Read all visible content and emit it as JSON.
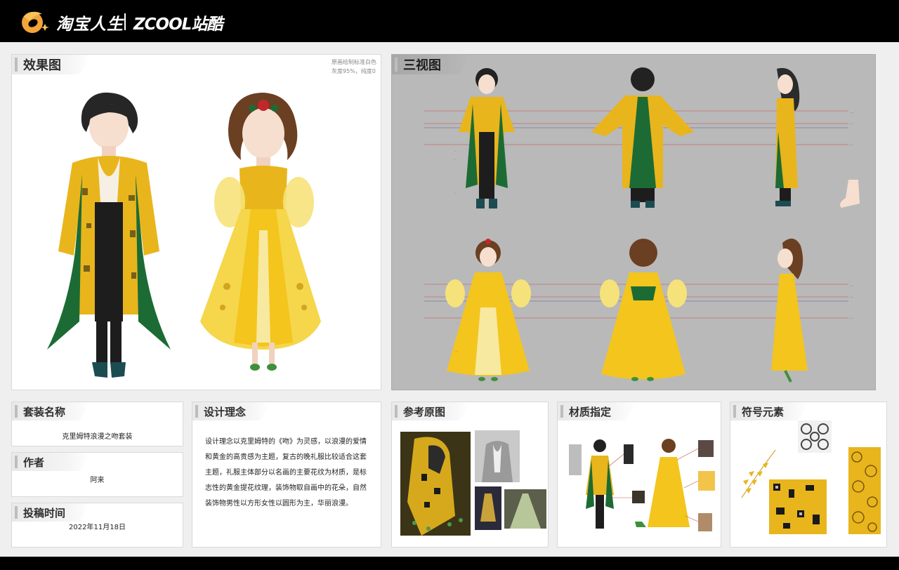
{
  "header": {
    "brand_primary": "淘宝人生",
    "brand_secondary": "ZCOOL站酷",
    "logo_icon": "taobao-life-logo-icon"
  },
  "effect_panel": {
    "title": "效果图",
    "note_line1": "原画绘制标准白色",
    "note_line2": "灰度95%，纯度0"
  },
  "three_view_panel": {
    "title": "三视图"
  },
  "outfit_name": {
    "title": "套装名称",
    "value": "克里姆特浪漫之吻套装"
  },
  "author": {
    "title": "作者",
    "value": "阿来"
  },
  "submit_time": {
    "title": "投稿时间",
    "value": "2022年11月18日"
  },
  "design_concept": {
    "title": "设计理念",
    "lines": [
      "设计理念以克里姆特的《吻》为灵感，以浪漫的爱情",
      "和黄金的高贵感为主题，复古的晚礼服比较适合这套",
      "主题，礼服主体部分以名画的主要花纹为材质，是标",
      "志性的黄金提花纹理，装饰物取自画中的花朵，自然",
      "装饰物男性以方形女性以圆形为主，华丽浪漫。"
    ]
  },
  "reference": {
    "title": "参考原图"
  },
  "material": {
    "title": "材质指定"
  },
  "symbols": {
    "title": "符号元素"
  },
  "colors": {
    "gold": "#e8b51c",
    "gold_light": "#f6d64a",
    "green": "#1c6b35",
    "dark": "#1a1a1a",
    "skin": "#f6dfcf",
    "hair": "#2a2a2a",
    "hair_brown": "#6a3f22"
  }
}
